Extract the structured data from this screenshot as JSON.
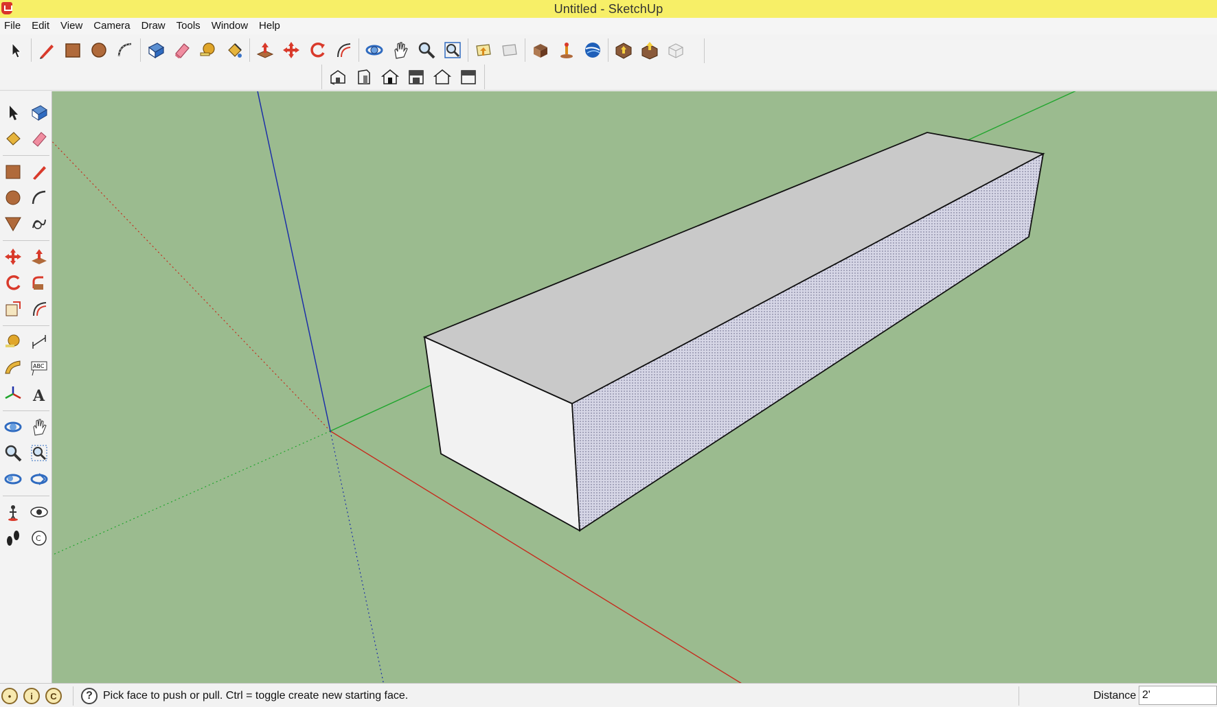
{
  "window": {
    "title": "Untitled - SketchUp"
  },
  "menu": {
    "items": [
      "File",
      "Edit",
      "View",
      "Camera",
      "Draw",
      "Tools",
      "Window",
      "Help"
    ]
  },
  "toolbar": {
    "main_icons": [
      "select-arrow-icon",
      "pencil-line-icon",
      "rectangle-icon",
      "circle-icon",
      "arc-icon",
      "make-component-icon",
      "eraser-icon",
      "tape-measure-icon",
      "paint-bucket-icon",
      "push-pull-icon",
      "move-icon",
      "rotate-icon",
      "offset-icon",
      "orbit-icon",
      "pan-icon",
      "zoom-icon",
      "zoom-extents-icon",
      "previous-view-icon",
      "next-view-icon",
      "3d-warehouse-icon",
      "add-location-icon",
      "google-earth-icon",
      "get-models-icon",
      "share-model-icon",
      "extension-warehouse-icon"
    ],
    "view_icons": [
      "iso-view-icon",
      "front-view-icon",
      "top-view-icon",
      "right-view-icon",
      "back-view-icon",
      "left-view-icon"
    ]
  },
  "left_toolbar": {
    "icons": [
      [
        "select-icon",
        "make-component-icon"
      ],
      [
        "paint-bucket-icon",
        "eraser-icon"
      ],
      [
        "rectangle-icon",
        "line-icon"
      ],
      [
        "circle-icon",
        "arc-icon"
      ],
      [
        "polygon-icon",
        "freehand-icon"
      ],
      [
        "move-icon",
        "push-pull-icon"
      ],
      [
        "rotate-icon",
        "follow-me-icon"
      ],
      [
        "scale-icon",
        "offset-icon"
      ],
      [
        "tape-measure-icon",
        "dimension-icon"
      ],
      [
        "protractor-icon",
        "text-icon"
      ],
      [
        "axes-icon",
        "3d-text-icon"
      ],
      [
        "orbit-icon",
        "pan-icon"
      ],
      [
        "zoom-icon",
        "zoom-window-icon"
      ],
      [
        "zoom-extents-icon",
        "previous-icon"
      ],
      [
        "position-camera-icon",
        "look-around-icon"
      ],
      [
        "walk-icon",
        "section-plane-icon"
      ]
    ]
  },
  "status": {
    "hint": "Pick face to push or pull.  Ctrl = toggle create new starting face.",
    "help_symbol": "?",
    "measurement_label": "Distance",
    "measurement_value": "2'"
  },
  "colors": {
    "title_bar": "#f7ef67",
    "viewport_ground": "#9bbb8f",
    "axis_red": "#c62a1c",
    "axis_green": "#1fa52c",
    "axis_blue": "#1c2fa8",
    "box_top": "#c9c9c9",
    "box_front": "#f2f2f2",
    "box_side": "#ccccdd"
  }
}
